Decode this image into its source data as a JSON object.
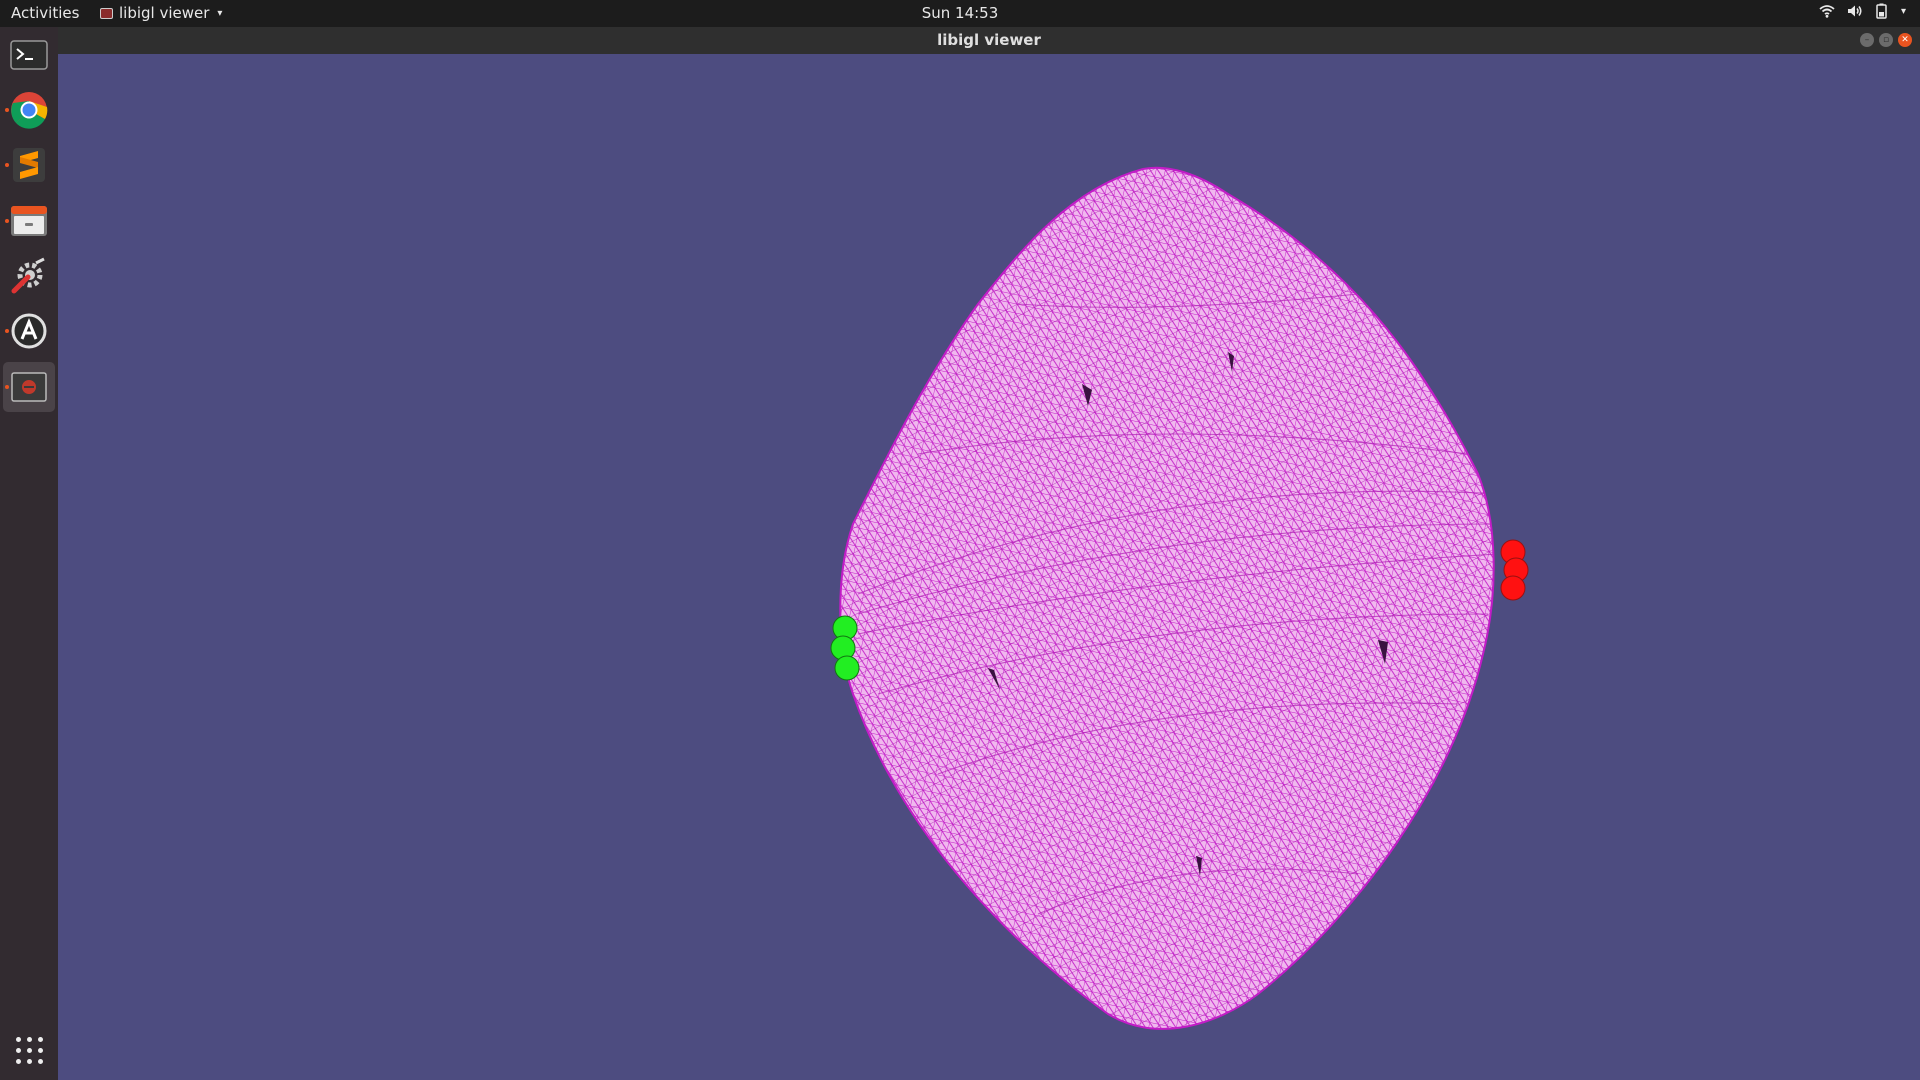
{
  "topbar": {
    "activities": "Activities",
    "app_menu": "libigl viewer",
    "clock": "Sun 14:53"
  },
  "window": {
    "title": "libigl viewer"
  },
  "dock": {
    "items": [
      {
        "name": "terminal",
        "icon": "terminal-icon"
      },
      {
        "name": "chrome",
        "icon": "chrome-icon"
      },
      {
        "name": "sublime-text",
        "icon": "sublime-text-icon"
      },
      {
        "name": "files",
        "icon": "files-icon"
      },
      {
        "name": "system-tools",
        "icon": "tools-icon"
      },
      {
        "name": "software-updater",
        "icon": "updater-icon"
      },
      {
        "name": "libigl-viewer",
        "icon": "libigl-viewer-icon"
      }
    ],
    "show_apps_icon": "apps-grid-icon"
  },
  "scene": {
    "background": "#4d4c80",
    "mesh_fill": "#f0b8ee",
    "mesh_wire": "#c21cc7",
    "source_marker_color": "#22ee22",
    "target_marker_color": "#ff1111"
  }
}
